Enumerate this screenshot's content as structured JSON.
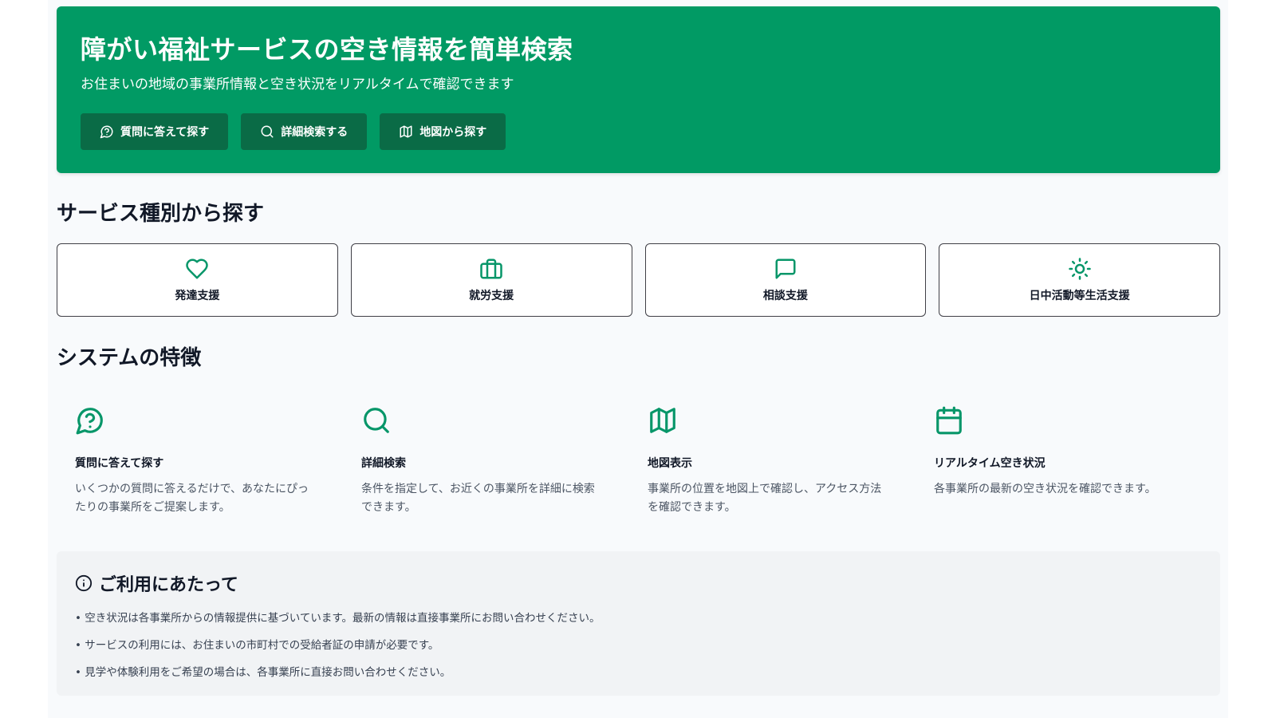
{
  "hero": {
    "title": "障がい福祉サービスの空き情報を簡単検索",
    "subtitle": "お住まいの地域の事業所情報と空き状況をリアルタイムで確認できます",
    "buttons": [
      {
        "label": "質問に答えて探す",
        "icon": "question-icon"
      },
      {
        "label": "詳細検索する",
        "icon": "search-icon"
      },
      {
        "label": "地図から探す",
        "icon": "map-icon"
      }
    ]
  },
  "services": {
    "title": "サービス種別から探す",
    "items": [
      {
        "label": "発達支援",
        "icon": "heart-icon"
      },
      {
        "label": "就労支援",
        "icon": "briefcase-icon"
      },
      {
        "label": "相談支援",
        "icon": "message-icon"
      },
      {
        "label": "日中活動等生活支援",
        "icon": "sun-icon"
      }
    ]
  },
  "features": {
    "title": "システムの特徴",
    "items": [
      {
        "title": "質問に答えて探す",
        "desc": "いくつかの質問に答えるだけで、あなたにぴったりの事業所をご提案します。",
        "icon": "question-icon"
      },
      {
        "title": "詳細検索",
        "desc": "条件を指定して、お近くの事業所を詳細に検索できます。",
        "icon": "search-icon"
      },
      {
        "title": "地図表示",
        "desc": "事業所の位置を地図上で確認し、アクセス方法を確認できます。",
        "icon": "map-icon"
      },
      {
        "title": "リアルタイム空き状況",
        "desc": "各事業所の最新の空き状況を確認できます。",
        "icon": "calendar-icon"
      }
    ]
  },
  "notice": {
    "title": "ご利用にあたって",
    "icon": "info-icon",
    "items": [
      "空き状況は各事業所からの情報提供に基づいています。最新の情報は直接事業所にお問い合わせください。",
      "サービスの利用には、お住まいの市町村での受給者証の申請が必要です。",
      "見学や体験利用をご希望の場合は、各事業所に直接お問い合わせください。"
    ]
  },
  "colors": {
    "brand": "#019a64",
    "button_dark": "#0a6b46",
    "icon_green": "#079669"
  }
}
